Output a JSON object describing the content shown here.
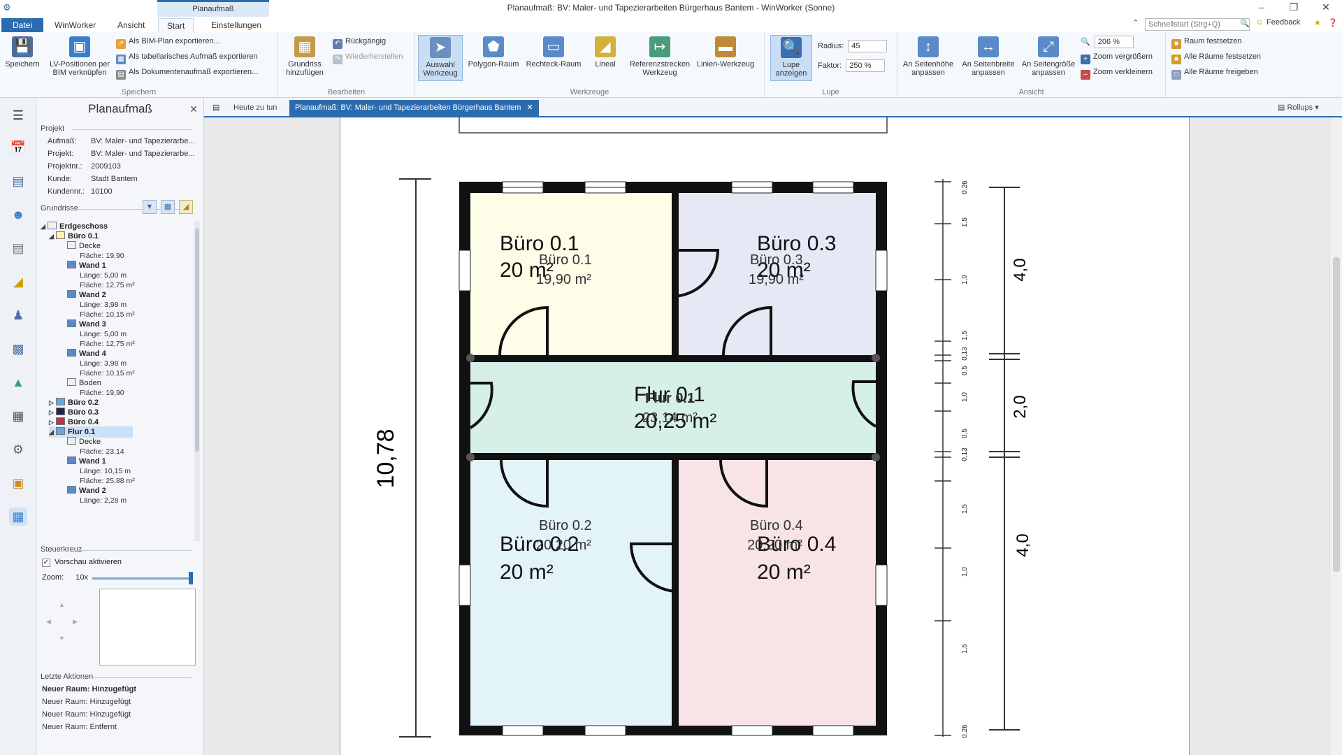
{
  "window": {
    "title": "Planaufmaß: BV: Maler- und Tapezierarbeiten Bürgerhaus Bantem - WinWorker (Sonne)",
    "context_tab": "Planaufmaß"
  },
  "ribbon_tabs": [
    "Datei",
    "WinWorker",
    "Ansicht",
    "Start",
    "Einstellungen"
  ],
  "quicksearch_placeholder": "Schnellstart (Strg+Q)",
  "feedback_label": "Feedback",
  "ribbon": {
    "speichern": {
      "label": "Speichern",
      "buttons": {
        "save": "Speichern",
        "lv_link": "LV-Positionen per BIM verknüpfen"
      },
      "small": {
        "bim_export": "Als BIM-Plan exportieren...",
        "table_export": "Als tabellarisches Aufmaß exportieren",
        "doc_export": "Als Dokumentenaufmaß exportieren..."
      }
    },
    "bearbeiten": {
      "label": "Bearbeiten",
      "buttons": {
        "grundriss": "Grundriss hinzufügen"
      },
      "small": {
        "undo": "Rückgängig",
        "redo": "Wiederherstellen"
      }
    },
    "werkzeuge": {
      "label": "Werkzeuge",
      "buttons": {
        "auswahl": "Auswahl Werkzeug",
        "polygon": "Polygon-Raum",
        "rechteck": "Rechteck-Raum",
        "lineal": "Lineal",
        "referenz": "Referenzstrecken Werkzeug",
        "linien": "Linien-Werkzeug"
      }
    },
    "lupe": {
      "label": "Lupe",
      "buttons": {
        "lupe": "Lupe anzeigen"
      },
      "radius_label": "Radius:",
      "radius_value": "45",
      "faktor_label": "Faktor:",
      "faktor_value": "250 %"
    },
    "ansicht": {
      "label": "Ansicht",
      "buttons": {
        "seitenhoehe": "An Seitenhöhe anpassen",
        "seitenbreite": "An Seitenbreite anpassen",
        "seitengroesse": "An Seitengröße anpassen"
      },
      "zoom_value": "206 %",
      "zoom_in": "Zoom vergrößern",
      "zoom_out": "Zoom verkleinern"
    },
    "raum": {
      "festsetzen": "Raum festsetzen",
      "alle_festsetzen": "Alle Räume festsetzen",
      "alle_freigeben": "Alle Räume freigeben"
    }
  },
  "panel": {
    "title": "Planaufmaß",
    "projekt_header": "Projekt",
    "projekt": [
      {
        "k": "Aufmaß:",
        "v": "BV: Maler- und Tapezierarbe..."
      },
      {
        "k": "Projekt:",
        "v": "BV: Maler- und Tapezierarbe..."
      },
      {
        "k": "Projektnr.:",
        "v": "2009103"
      },
      {
        "k": "Kunde:",
        "v": "Stadt Bantem"
      },
      {
        "k": "Kundennr.:",
        "v": "10100"
      }
    ],
    "grundrisse_header": "Grundrisse",
    "tree": [
      {
        "label": "Erdgeschoss"
      },
      {
        "label": "Büro 0.1"
      },
      {
        "label": "Decke"
      },
      {
        "label": "Fläche: 19,90"
      },
      {
        "label": "Wand 1"
      },
      {
        "label": "Länge: 5,00 m"
      },
      {
        "label": "Fläche: 12,75 m²"
      },
      {
        "label": "Wand 2"
      },
      {
        "label": "Länge: 3,98 m"
      },
      {
        "label": "Fläche: 10,15 m²"
      },
      {
        "label": "Wand 3"
      },
      {
        "label": "Länge: 5,00 m"
      },
      {
        "label": "Fläche: 12,75 m²"
      },
      {
        "label": "Wand 4"
      },
      {
        "label": "Länge: 3,98 m"
      },
      {
        "label": "Fläche: 10,15 m²"
      },
      {
        "label": "Boden"
      },
      {
        "label": "Fläche: 19,90"
      },
      {
        "label": "Büro 0.2"
      },
      {
        "label": "Büro 0.3"
      },
      {
        "label": "Büro 0.4"
      },
      {
        "label": "Flur 0.1"
      },
      {
        "label": "Decke"
      },
      {
        "label": "Fläche: 23,14"
      },
      {
        "label": "Wand 1"
      },
      {
        "label": "Länge: 10,15 m"
      },
      {
        "label": "Fläche: 25,88 m²"
      },
      {
        "label": "Wand 2"
      },
      {
        "label": "Länge: 2,28 m"
      }
    ],
    "steuerkreuz_header": "Steuerkreuz",
    "vorschau_label": "Vorschau aktivieren",
    "zoom_label": "Zoom:",
    "zoom_value": "10x",
    "letzte_header": "Letzte Aktionen",
    "actions": [
      "Neuer Raum: Hinzugefügt",
      "Neuer Raum: Hinzugefügt",
      "Neuer Raum: Hinzugefügt",
      "Neuer Raum: Entfernt"
    ]
  },
  "doc_tabs": {
    "heute": "Heute zu tun",
    "active": "Planaufmaß: BV: Maler- und Tapezierarbeiten Bürgerhaus Bantem",
    "rollups": "Rollups"
  },
  "plan": {
    "overall_dim": "10,78",
    "rooms": [
      {
        "name": "Büro 0.1",
        "area": "20 m²",
        "sub_name": "Büro 0.1",
        "sub_area": "19,90 m²",
        "fill": "#fdfde8"
      },
      {
        "name": "Büro 0.3",
        "area": "20 m²",
        "sub_name": "Büro 0.3",
        "sub_area": "19,90 m²",
        "fill": "#e6e9f5"
      },
      {
        "name": "Flur 0.1",
        "area": "20,25 m²",
        "sub_name": "Flur 0.1",
        "sub_area": "23,14 m²",
        "fill": "#d6efe8"
      },
      {
        "name": "Büro 0.2",
        "area": "20 m²",
        "sub_name": "Büro 0.2",
        "sub_area": "20,20 m²",
        "fill": "#e3f3fa"
      },
      {
        "name": "Büro 0.4",
        "area": "20 m²",
        "sub_name": "Büro 0.4",
        "sub_area": "20,20 m²",
        "fill": "#f8e3e6"
      }
    ],
    "right_dims": [
      "4,0",
      "2,0",
      "4,0"
    ],
    "tick_labels": [
      "0,26",
      "1,5",
      "1,0",
      "1,5",
      "0,13",
      "0,5",
      "1,0",
      "0,5",
      "0,13",
      "1,5",
      "1,0",
      "1,5",
      "0,26"
    ]
  }
}
